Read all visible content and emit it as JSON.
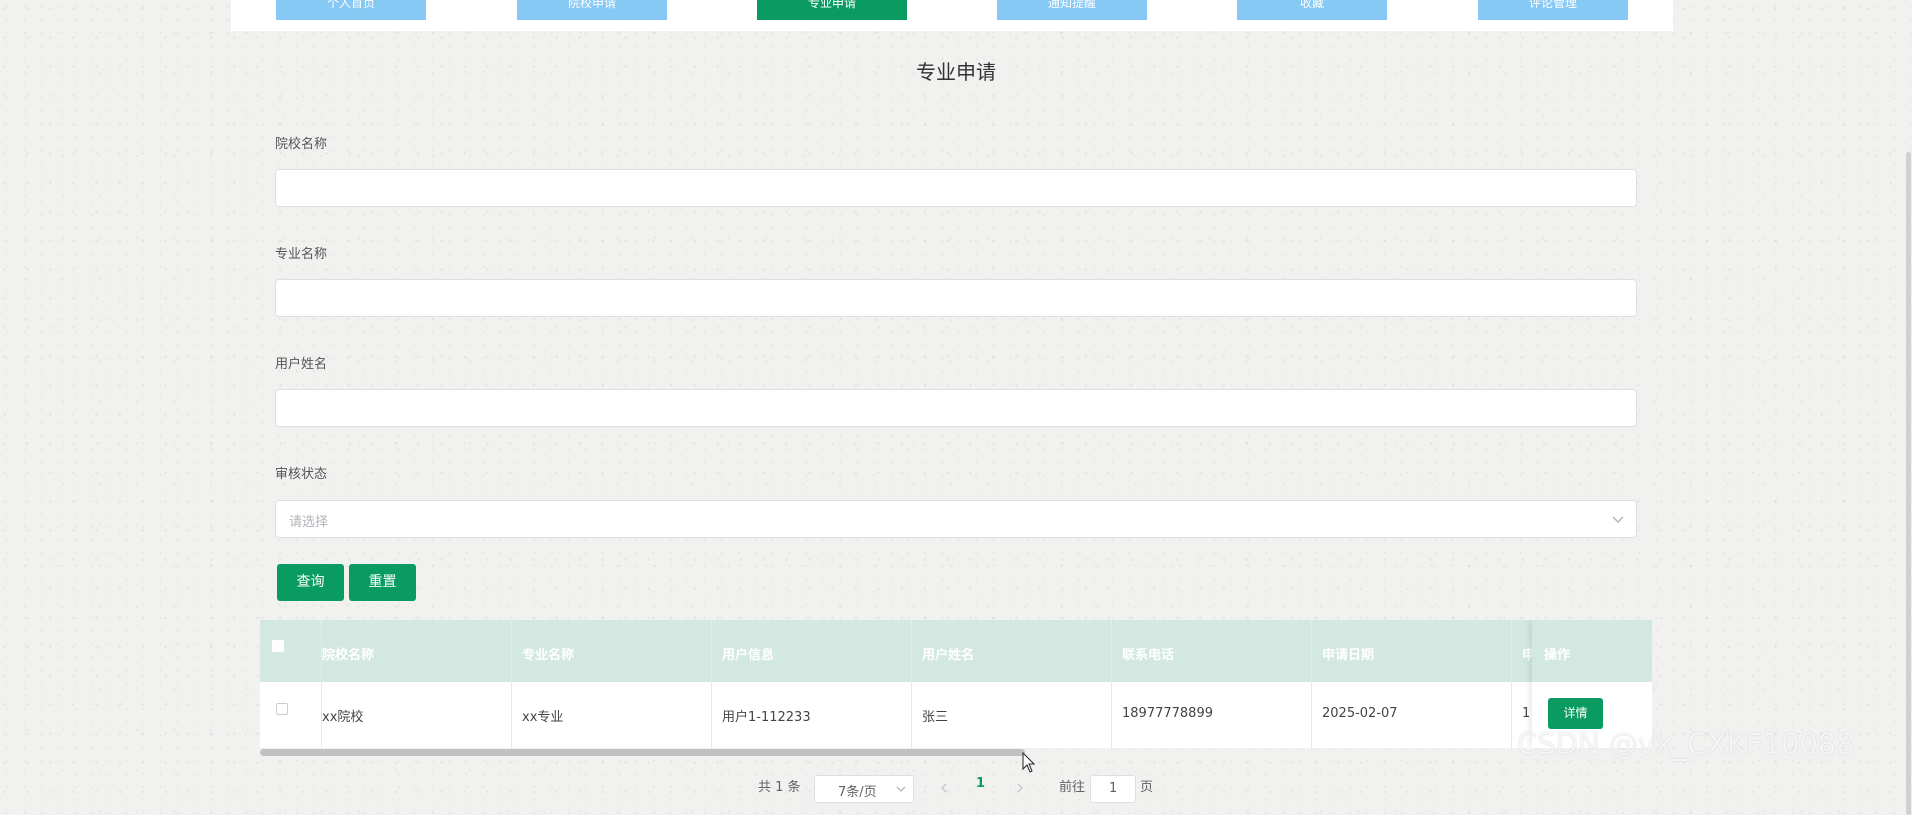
{
  "nav": {
    "tabs": [
      {
        "label": "个人首页",
        "active": false
      },
      {
        "label": "院校申请",
        "active": false
      },
      {
        "label": "专业申请",
        "active": true
      },
      {
        "label": "通知提醒",
        "active": false
      },
      {
        "label": "收藏",
        "active": false
      },
      {
        "label": "评论管理",
        "active": false
      }
    ]
  },
  "page": {
    "title": "专业申请"
  },
  "form": {
    "school_label": "院校名称",
    "major_label": "专业名称",
    "username_label": "用户姓名",
    "status_label": "审核状态",
    "status_placeholder": "请选择",
    "query_button": "查询",
    "reset_button": "重置"
  },
  "table": {
    "headers": [
      "院校名称",
      "专业名称",
      "用户信息",
      "用户姓名",
      "联系电话",
      "申请日期",
      "申",
      "操作"
    ],
    "rows": [
      {
        "school": "xx院校",
        "major": "xx专业",
        "user_info": "用户1-112233",
        "user_name": "张三",
        "phone": "18977778899",
        "date": "2025-02-07",
        "partial": "1",
        "action": "详情"
      }
    ]
  },
  "pagination": {
    "total": "共 1 条",
    "page_size": "7条/页",
    "current": "1",
    "goto_label": "前往",
    "goto_value": "1",
    "page_suffix": "页"
  },
  "watermark": "CSDN @vx_CXKF10088",
  "colors": {
    "accent": "#0a9b62",
    "tab_inactive": "#86c9f5",
    "table_header": "#d2e8e0"
  }
}
